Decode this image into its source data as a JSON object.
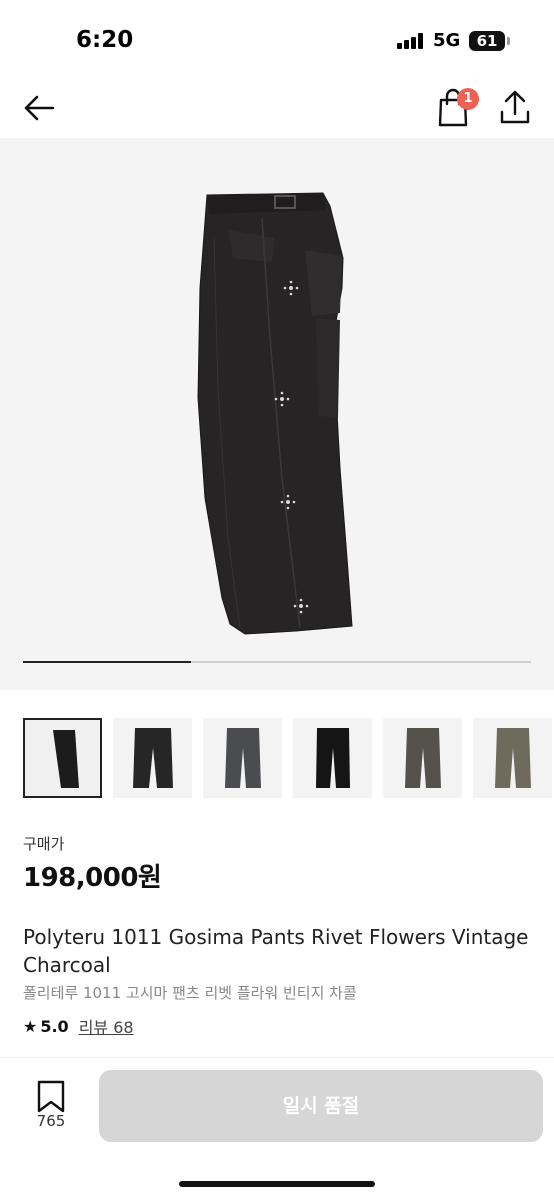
{
  "status_bar": {
    "time": "6:20",
    "network": "5G",
    "battery": "61"
  },
  "nav": {
    "cart_badge": "1"
  },
  "gallery": {
    "progress_fraction": 0.33,
    "thumb_colors": [
      "#1c1c1c",
      "#262626",
      "#4a4c50",
      "#151515",
      "#55524c",
      "#6e6b5c"
    ],
    "selected_index": 0
  },
  "product": {
    "price_label": "구매가",
    "price": "198,000원",
    "title_en": "Polyteru 1011 Gosima Pants Rivet Flowers Vintage Charcoal",
    "title_ko": "폴리테루 1011 고시마 팬츠 리벳 플라워 빈티지 차콜",
    "rating": "5.0",
    "review_label": "리뷰 68"
  },
  "bottom_bar": {
    "bookmark_count": "765",
    "buy_label": "일시 품절"
  },
  "colors": {
    "badge": "#ef6253",
    "buy_button_disabled": "#d6d6d6",
    "hero_bg": "#f4f4f4"
  }
}
